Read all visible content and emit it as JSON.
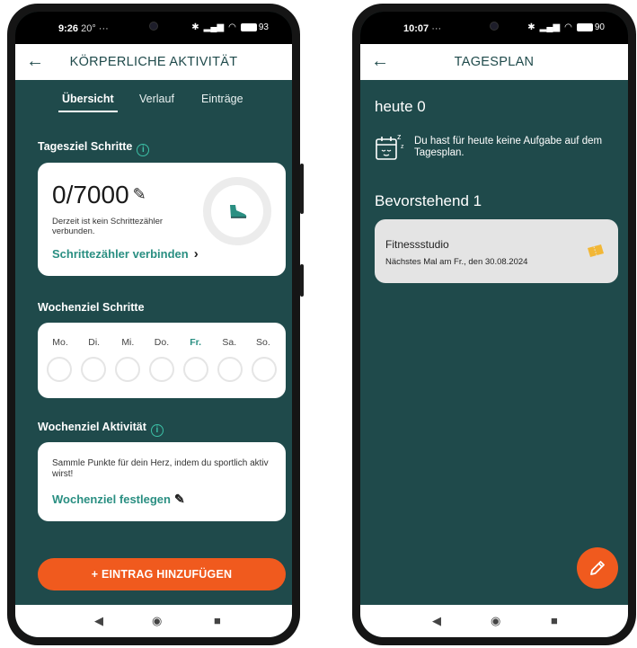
{
  "left_phone": {
    "status": {
      "time": "9:26",
      "extra": "20° ···",
      "battery": "93"
    },
    "appbar": {
      "back_icon": "arrow-left-icon",
      "title": "KÖRPERLICHE AKTIVITÄT"
    },
    "tabs": [
      {
        "label": "Übersicht",
        "active": true
      },
      {
        "label": "Verlauf",
        "active": false
      },
      {
        "label": "Einträge",
        "active": false
      }
    ],
    "daily_goal": {
      "title": "Tagesziel Schritte",
      "value": "0/7000",
      "note": "Derzeit ist kein Schrittezähler verbunden.",
      "link": "Schrittezähler verbinden",
      "progress": 0
    },
    "weekly_steps": {
      "title": "Wochenziel Schritte",
      "days": [
        "Mo.",
        "Di.",
        "Mi.",
        "Do.",
        "Fr.",
        "Sa.",
        "So."
      ],
      "today": "Fr."
    },
    "weekly_activity": {
      "title": "Wochenziel Aktivität",
      "note": "Sammle Punkte für dein Herz, indem du sportlich aktiv wirst!",
      "link": "Wochenziel festlegen"
    },
    "add_button": "+ EINTRAG HINZUFÜGEN"
  },
  "right_phone": {
    "status": {
      "time": "10:07",
      "extra": "··· ",
      "battery": "90"
    },
    "appbar": {
      "back_icon": "arrow-left-icon",
      "title": "TAGESPLAN"
    },
    "today": {
      "label": "heute",
      "count": "0",
      "empty_text": "Du hast für heute keine Aufgabe auf dem Tagesplan."
    },
    "upcoming": {
      "label": "Bevorstehend",
      "count": "1"
    },
    "task": {
      "name": "Fitnessstudio",
      "date": "Nächstes Mal am Fr., den 30.08.2024"
    }
  },
  "colors": {
    "background": "#1f4a4b",
    "accent": "#2a8f82",
    "button": "#f05a1e",
    "ticket": "#f2b736"
  }
}
